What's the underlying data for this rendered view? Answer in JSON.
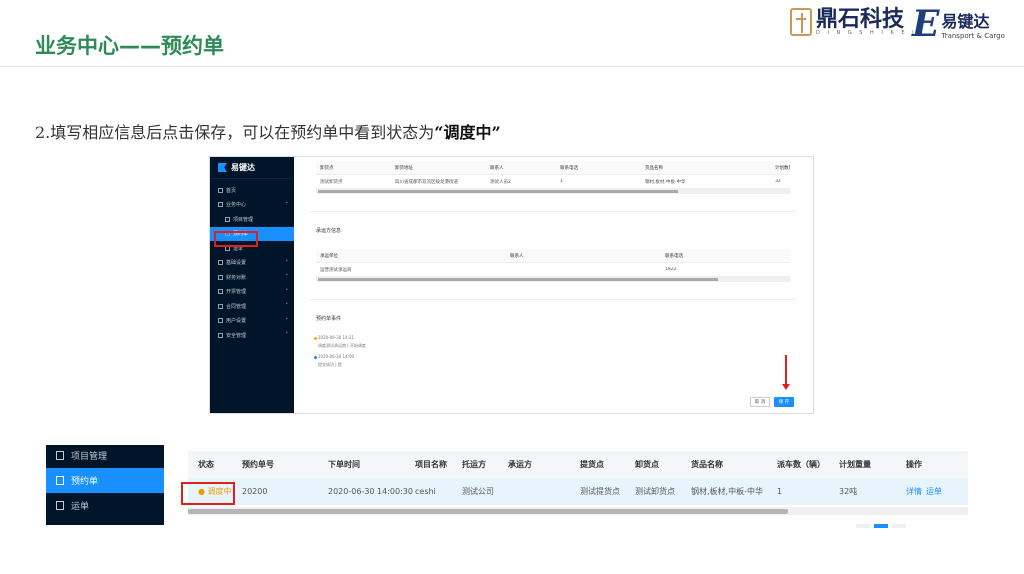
{
  "slide": {
    "title": "业务中心——预约单",
    "instruction_prefix": "2.填写相应信息后点击保存，可以在预约单中看到状态为",
    "instruction_bold": "“调度中”",
    "logo1": {
      "name": "鼎石科技",
      "sub": "D I N G S H I K E J I"
    },
    "logo2": {
      "name": "易键达",
      "sub": "Transport & Cargo"
    }
  },
  "shot1": {
    "brand": "易键达",
    "menu": [
      {
        "label": "首页",
        "level": 0
      },
      {
        "label": "业务中心",
        "level": 0,
        "expanded": true
      },
      {
        "label": "项目管理",
        "level": 1
      },
      {
        "label": "预约单",
        "level": 1,
        "active": true
      },
      {
        "label": "运单",
        "level": 1
      },
      {
        "label": "基础设置",
        "level": 0
      },
      {
        "label": "财务对账",
        "level": 0
      },
      {
        "label": "开票管理",
        "level": 0
      },
      {
        "label": "合同管理",
        "level": 0
      },
      {
        "label": "用户设置",
        "level": 0
      },
      {
        "label": "安全管理",
        "level": 0
      }
    ],
    "unload_table": {
      "headers": [
        "卸货点",
        "卸货地址",
        "联系人",
        "联系电话",
        "货品名称",
        "计划数量"
      ],
      "row": [
        "测试卸货点",
        "四川省成都市双流区蛟龙港街道",
        "测试人员2",
        "1",
        "钢材,板材,中板-中华",
        "32"
      ]
    },
    "carrier_section": "承运方信息",
    "carrier_table": {
      "headers": [
        "承运单位",
        "联系人",
        "联系电话"
      ],
      "row": [
        "运营测试承运商",
        "",
        "1822"
      ]
    },
    "events_section": "预约单事件",
    "events": [
      {
        "time": "2020-06-30 14:21",
        "text": "调度测试承运商 | 开始调度"
      },
      {
        "time": "2020-06-30 14:00",
        "text": "提交成功 | 提"
      }
    ],
    "cancel": "取 消",
    "save": "保 存"
  },
  "shot2": {
    "menu": [
      {
        "label": "项目管理"
      },
      {
        "label": "预约单",
        "active": true
      },
      {
        "label": "运单"
      }
    ],
    "headers": [
      "状态",
      "预约单号",
      "下单时间",
      "项目名称",
      "托运方",
      "承运方",
      "提货点",
      "卸货点",
      "货品名称",
      "派车数（辆）",
      "计划重量",
      "操作"
    ],
    "row": {
      "status": "调度中",
      "order_no": "20200",
      "order_time": "2020-06-30 14:00:30",
      "project": "ceshi",
      "shipper": "测试公司",
      "carrier": "",
      "pickup": "测试提货点",
      "unload": "测试卸货点",
      "goods": "钢材,板材,中板-中华",
      "trucks": "1",
      "weight": "32吨",
      "action_detail": "详情",
      "action_waybill": "运单"
    }
  },
  "colors": {
    "title_green": "#2e8b57",
    "sidebar_dark": "#001529",
    "primary_blue": "#1890ff",
    "highlight_red": "#e0201a",
    "status_orange": "#f39800"
  }
}
